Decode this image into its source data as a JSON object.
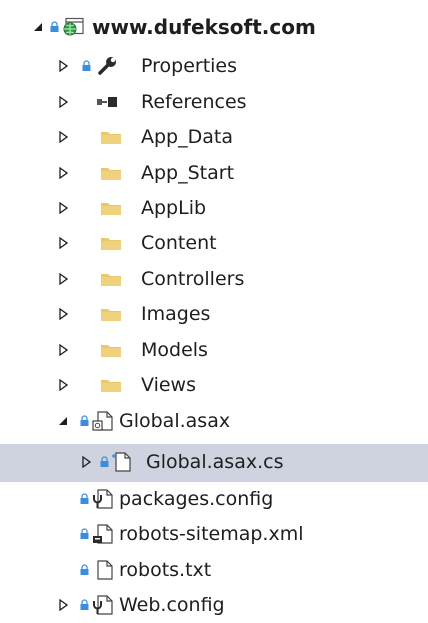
{
  "solution_explorer": {
    "root": {
      "label": "www.dufeksoft.com",
      "icon": "web-project-icon"
    },
    "items": [
      {
        "label": "Properties",
        "icon": "wrench-icon"
      },
      {
        "label": "References",
        "icon": "references-icon"
      },
      {
        "label": "App_Data",
        "icon": "folder-icon"
      },
      {
        "label": "App_Start",
        "icon": "folder-icon"
      },
      {
        "label": "AppLib",
        "icon": "folder-icon"
      },
      {
        "label": "Content",
        "icon": "folder-icon"
      },
      {
        "label": "Controllers",
        "icon": "folder-icon"
      },
      {
        "label": "Images",
        "icon": "folder-icon"
      },
      {
        "label": "Models",
        "icon": "folder-icon"
      },
      {
        "label": "Views",
        "icon": "folder-icon"
      },
      {
        "label": "Global.asax",
        "icon": "asax-file-icon"
      },
      {
        "label": "Global.asax.cs",
        "icon": "cs-file-icon",
        "selected": true
      },
      {
        "label": "packages.config",
        "icon": "config-file-icon"
      },
      {
        "label": "robots-sitemap.xml",
        "icon": "xml-file-icon"
      },
      {
        "label": "robots.txt",
        "icon": "text-file-icon"
      },
      {
        "label": "Web.config",
        "icon": "config-file-icon"
      }
    ]
  },
  "colors": {
    "selection": "#cfd2df",
    "folder": "#e8c86e",
    "lock": "#3b8ede",
    "text": "#1e1e1e"
  }
}
